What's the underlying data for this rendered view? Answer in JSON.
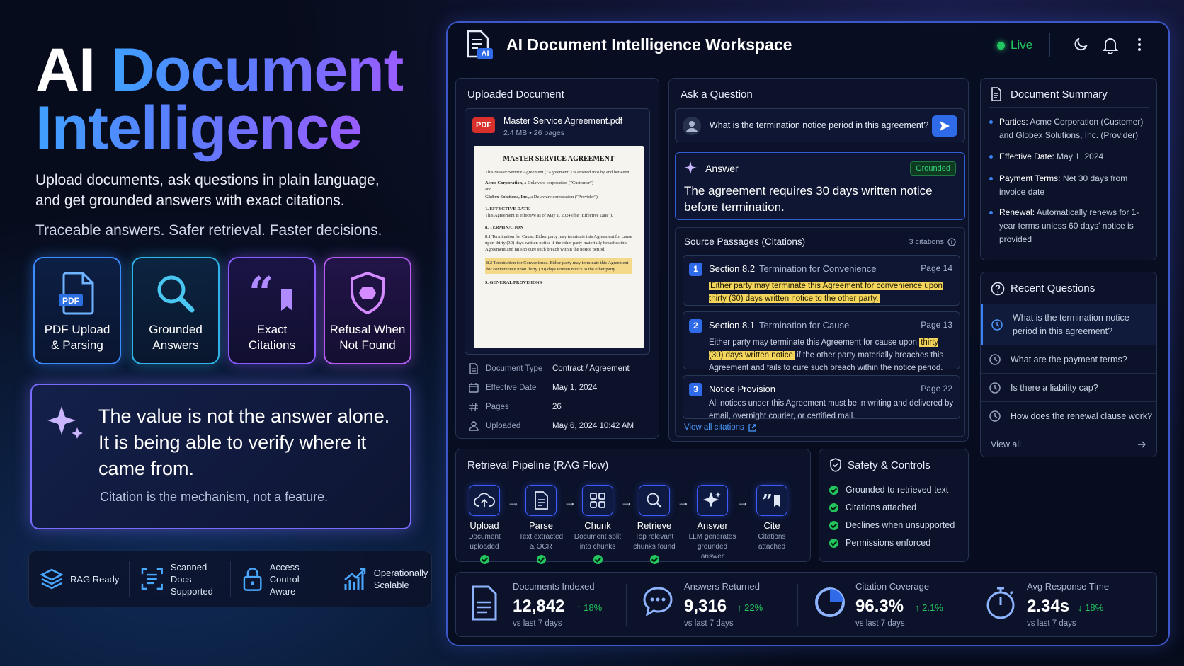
{
  "hero": {
    "title_word1": "AI",
    "title_word2": "Document",
    "title_line2": "Intelligence",
    "subtitle": "Upload documents, ask questions in plain language, and get grounded answers with exact citations.",
    "tagline": "Traceable answers. Safer retrieval. Faster decisions."
  },
  "features": [
    {
      "line1": "PDF Upload",
      "line2": "& Parsing",
      "icon": "pdf-icon"
    },
    {
      "line1": "Grounded",
      "line2": "Answers",
      "icon": "search-icon"
    },
    {
      "line1": "Exact",
      "line2": "Citations",
      "icon": "quote-icon"
    },
    {
      "line1": "Refusal When",
      "line2": "Not Found",
      "icon": "shield-icon"
    }
  ],
  "quote": {
    "text": "The value is not the answer alone. It is being able to verify where it came from.",
    "sub": "Citation is the mechanism, not a feature."
  },
  "badges": [
    {
      "line1": "RAG Ready",
      "line2": "",
      "icon": "layers-icon"
    },
    {
      "line1": "Scanned Docs",
      "line2": "Supported",
      "icon": "scan-icon"
    },
    {
      "line1": "Access-Control",
      "line2": "Aware",
      "icon": "lock-icon"
    },
    {
      "line1": "Operationally",
      "line2": "Scalable",
      "icon": "growth-chart-icon"
    }
  ],
  "app": {
    "title": "AI Document Intelligence Workspace",
    "logo_badge": "AI",
    "status": "Live",
    "accent": "#3b82f6",
    "live_color": "#22c55e"
  },
  "uploaded": {
    "title": "Uploaded Document",
    "file_badge": "PDF",
    "file_name": "Master Service Agreement.pdf",
    "file_meta": "2.4 MB  •  26 pages",
    "doc": {
      "heading": "MASTER SERVICE AGREEMENT",
      "p1": "This Master Service Agreement (\"Agreement\") is entered into by and between:",
      "p2a": "Acme Corporation,",
      "p2b": " a Delaware corporation (\"Customer\")",
      "and": "and",
      "p3a": "Globex Solutions, Inc.,",
      "p3b": " a Delaware corporation (\"Provider\")",
      "s1": "1. EFFECTIVE DATE",
      "s1t": "This Agreement is effective as of May 1, 2024 (the \"Effective Date\").",
      "s8": "8. TERMINATION",
      "s81": "8.1  Termination for Cause. Either party may terminate this Agreement for cause upon thirty (30) days written notice if the other party materially breaches this Agreement and fails to cure such breach within the notice period.",
      "s82": "8.2  Termination for Convenience. Either party may terminate this Agreement for convenience upon thirty (30) days written notice to the other party.",
      "s9": "9. GENERAL PROVISIONS"
    },
    "meta": [
      {
        "k": "Document Type",
        "v": "Contract / Agreement"
      },
      {
        "k": "Effective Date",
        "v": "May 1, 2024"
      },
      {
        "k": "Pages",
        "v": "26"
      },
      {
        "k": "Uploaded",
        "v": "May 6, 2024 10:42 AM"
      }
    ]
  },
  "ask": {
    "title": "Ask a Question",
    "question": "What is the termination notice period in this agreement?",
    "answer_label": "Answer",
    "grounded": "Grounded",
    "answer": "The agreement requires 30 days written notice before termination."
  },
  "sources": {
    "title": "Source Passages (Citations)",
    "count": "3 citations",
    "items": [
      {
        "num": "1",
        "section": "Section 8.2",
        "sub": "Termination for Convenience",
        "page": "Page 14",
        "pre": "",
        "hl": "Either party may terminate this Agreement for convenience upon thirty (30) days written notice to the other party.",
        "post": ""
      },
      {
        "num": "2",
        "section": "Section 8.1",
        "sub": "Termination for Cause",
        "page": "Page 13",
        "pre": "Either party may terminate this Agreement for cause upon ",
        "hl": "thirty (30) days written notice",
        "post": " if the other party materially breaches this Agreement and fails to cure such breach within the notice period."
      },
      {
        "num": "3",
        "section": "Notice Provision",
        "sub": "",
        "page": "Page 22",
        "pre": "All notices under this Agreement must be in writing and delivered by email, overnight courier, or certified mail.",
        "hl": "",
        "post": ""
      }
    ],
    "view_all": "View all citations"
  },
  "summary": {
    "title": "Document Summary",
    "items": [
      {
        "k": "Parties:",
        "v": " Acme Corporation (Customer) and Globex Solutions, Inc. (Provider)"
      },
      {
        "k": "Effective Date:",
        "v": " May 1, 2024"
      },
      {
        "k": "Payment Terms:",
        "v": " Net 30 days from invoice date"
      },
      {
        "k": "Renewal:",
        "v": " Automatically renews for 1-year terms unless 60 days' notice is provided"
      }
    ]
  },
  "recent": {
    "title": "Recent Questions",
    "items": [
      "What is the termination notice period in this agreement?",
      "What are the payment terms?",
      "Is there a liability cap?",
      "How does the renewal clause work?"
    ],
    "view_all": "View all"
  },
  "pipeline": {
    "title": "Retrieval Pipeline  (RAG Flow)",
    "steps": [
      {
        "name": "Upload",
        "d1": "Document",
        "d2": "uploaded",
        "icon": "cloud-upload-icon"
      },
      {
        "name": "Parse",
        "d1": "Text extracted",
        "d2": "& OCR",
        "icon": "document-icon"
      },
      {
        "name": "Chunk",
        "d1": "Document split",
        "d2": "into chunks",
        "icon": "grid-icon"
      },
      {
        "name": "Retrieve",
        "d1": "Top relevant",
        "d2": "chunks found",
        "icon": "search-icon"
      },
      {
        "name": "Answer",
        "d1": "LLM generates",
        "d2": "grounded answer",
        "icon": "sparkle-icon"
      },
      {
        "name": "Cite",
        "d1": "Citations",
        "d2": "attached",
        "icon": "quote-icon"
      }
    ]
  },
  "safety": {
    "title": "Safety & Controls",
    "items": [
      "Grounded to retrieved text",
      "Citations attached",
      "Declines when unsupported",
      "Permissions enforced"
    ]
  },
  "stats": [
    {
      "label": "Documents Indexed",
      "value": "12,842",
      "change": "18%",
      "dir": "up",
      "vs": "vs last 7 days",
      "icon": "document-icon"
    },
    {
      "label": "Answers Returned",
      "value": "9,316",
      "change": "22%",
      "dir": "up",
      "vs": "vs last 7 days",
      "icon": "chat-icon"
    },
    {
      "label": "Citation Coverage",
      "value": "96.3%",
      "change": "2.1%",
      "dir": "up",
      "vs": "vs last 7 days",
      "icon": "pie-icon"
    },
    {
      "label": "Avg Response Time",
      "value": "2.34s",
      "change": "18%",
      "dir": "down",
      "vs": "vs last 7 days",
      "icon": "stopwatch-icon"
    }
  ]
}
